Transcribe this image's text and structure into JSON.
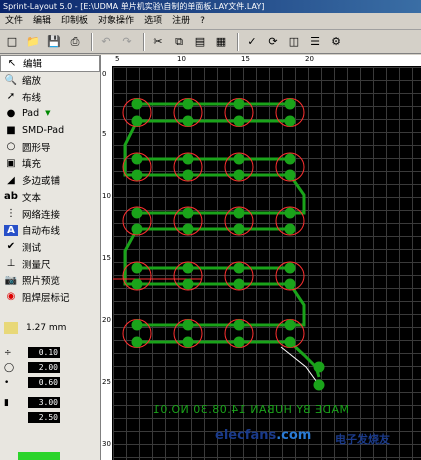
{
  "window": {
    "title": "Sprint-Layout 5.0 - [E:\\UDMA 单片机实验\\自制的单面板.LAY文件.LAY]"
  },
  "menu": [
    "文件",
    "编辑",
    "印制板",
    "对象操作",
    "选项",
    "注册",
    "?"
  ],
  "toolbar": {
    "icons": [
      "new-icon",
      "open-icon",
      "save-icon",
      "print-icon",
      "undo-icon",
      "redo-icon",
      "cut-icon",
      "copy-icon",
      "paste-icon",
      "delete-icon",
      "check-icon",
      "rotate-icon",
      "mirror-icon",
      "align-icon",
      "settings-icon"
    ]
  },
  "tools": [
    {
      "label": "编辑",
      "icon": "pointer-icon",
      "active": true
    },
    {
      "label": "缩放",
      "icon": "zoom-icon"
    },
    {
      "label": "布线",
      "icon": "track-icon"
    },
    {
      "label": "Pad",
      "icon": "pad-icon",
      "dropdown": true
    },
    {
      "label": "SMD-Pad",
      "icon": "smd-pad-icon"
    },
    {
      "label": "圆形导",
      "icon": "circle-icon"
    },
    {
      "label": "填充",
      "icon": "fill-icon"
    },
    {
      "label": "多边或铺",
      "icon": "polygon-icon"
    },
    {
      "label": "文本",
      "icon": "text-icon"
    },
    {
      "label": "网络连接",
      "icon": "netlist-icon"
    },
    {
      "label": "自动布线",
      "icon": "autoroute-icon"
    },
    {
      "label": "测试",
      "icon": "test-icon"
    },
    {
      "label": "测量尺",
      "icon": "ruler-icon"
    },
    {
      "label": "照片预览",
      "icon": "photo-icon"
    },
    {
      "label": "阻焊层标记",
      "icon": "soldermask-icon"
    }
  ],
  "params": {
    "track_width": "1.27 mm",
    "grid": "0.10",
    "pad_outer": "2.00",
    "pad_inner": "0.60",
    "smd_w": "3.00",
    "smd_h": "2.50"
  },
  "ruler": {
    "h_labels": [
      "5",
      "10",
      "15",
      "20"
    ],
    "v_labels": [
      "0",
      "5",
      "10",
      "15",
      "20",
      "25",
      "30"
    ]
  },
  "board": {
    "mirrored_text": "MADE BY HUBAN 14.08.30 NO.01"
  },
  "watermark": {
    "site": "elecfans",
    "domain": ".com",
    "cn": "电子发烧友"
  },
  "colors": {
    "copper": "#1aa31a",
    "pad_ring": "#ff3030",
    "canvas": "#000000"
  }
}
